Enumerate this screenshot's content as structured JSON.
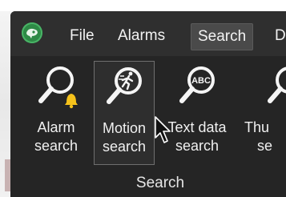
{
  "menubar": {
    "items": [
      {
        "label": "File",
        "active": false
      },
      {
        "label": "Alarms",
        "active": false
      },
      {
        "label": "Search",
        "active": true
      },
      {
        "label": "D",
        "active": false
      }
    ]
  },
  "ribbon": {
    "buttons": [
      {
        "line1": "Alarm",
        "line2": "search",
        "icon": "alarm-search-icon",
        "active": false
      },
      {
        "line1": "Motion",
        "line2": "search",
        "icon": "motion-search-icon",
        "active": true
      },
      {
        "line1": "Text data",
        "line2": "search",
        "icon": "text-data-search-icon",
        "active": false
      },
      {
        "line1": "Thu",
        "line2": "se",
        "icon": "thumbnail-search-icon",
        "active": false
      }
    ],
    "group_label": "Search",
    "icon_glyph_text": "ABC"
  },
  "colors": {
    "background": "#2b2b2b",
    "ribbon": "#252525",
    "active_menu": "#4a4a4a",
    "bell": "#f5c21b",
    "logo": "#2e8a46"
  }
}
